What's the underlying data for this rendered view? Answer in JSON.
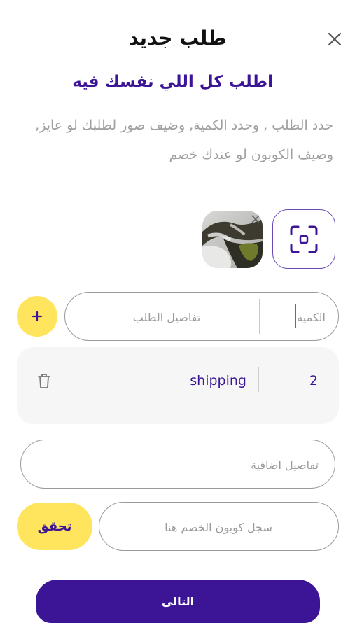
{
  "header": {
    "title": "طلب جديد",
    "close_icon": "close-icon"
  },
  "intro": {
    "headline": "اطلب كل اللي نفسك فيه",
    "description": "حدد الطلب , وحدد الكمية, وضيف صور لطلبك لو عايز, وضيف الكوبون لو عندك خصم"
  },
  "attachments": {
    "scan_icon": "scan-icon",
    "thumbnail_icon": "photo-thumbnail",
    "remove_icon": "close-icon"
  },
  "order_entry": {
    "quantity_placeholder": "الكمية",
    "details_placeholder": "تفاصيل الطلب",
    "add_icon": "plus-icon",
    "add_label": "+"
  },
  "items": [
    {
      "quantity": "2",
      "name": "shipping",
      "delete_icon": "trash-icon"
    }
  ],
  "extra_details": {
    "placeholder": "تفاصيل اضافية"
  },
  "coupon": {
    "placeholder": "سجل كوبون الخصم هنا",
    "verify_label": "تحقق"
  },
  "footer": {
    "next_label": "التالي"
  },
  "colors": {
    "primary": "#3b1596",
    "accent": "#ffe55e",
    "border": "#9a9a9a",
    "muted_text": "#a0a0a0",
    "card_bg": "#f6f6f6"
  }
}
